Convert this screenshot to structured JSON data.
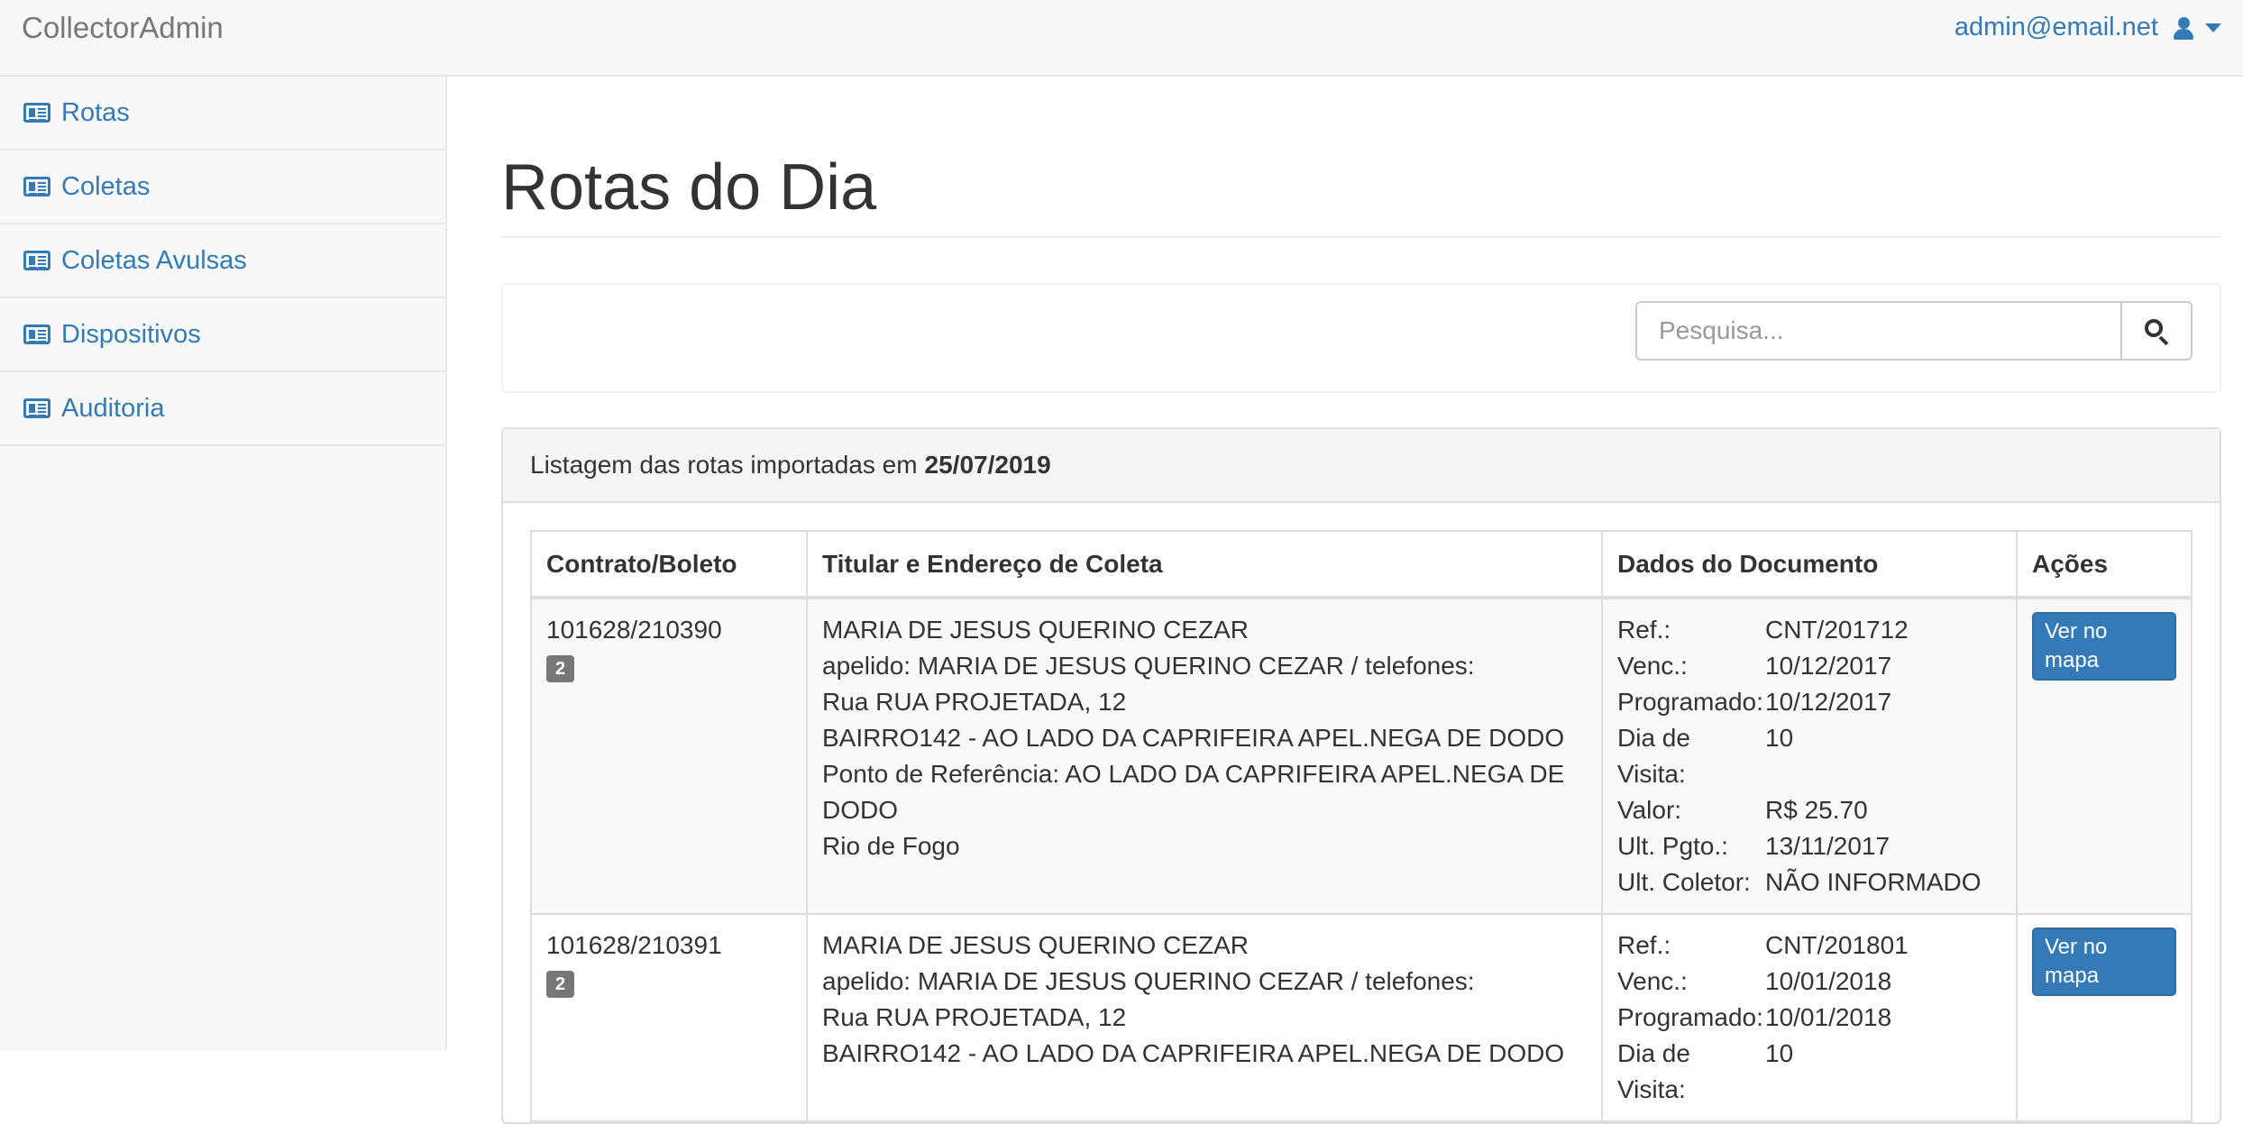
{
  "navbar": {
    "brand": "CollectorAdmin",
    "user_email": "admin@email.net",
    "user_icon": "user-icon",
    "caret_icon": "caret-down-icon"
  },
  "sidebar": {
    "items": [
      {
        "label": "Rotas",
        "icon": "newspaper-icon"
      },
      {
        "label": "Coletas",
        "icon": "newspaper-icon"
      },
      {
        "label": "Coletas Avulsas",
        "icon": "newspaper-icon"
      },
      {
        "label": "Dispositivos",
        "icon": "newspaper-icon"
      },
      {
        "label": "Auditoria",
        "icon": "newspaper-icon"
      }
    ]
  },
  "main": {
    "title": "Rotas do Dia",
    "search": {
      "placeholder": "Pesquisa...",
      "value": "",
      "icon": "search-icon"
    },
    "panel": {
      "heading_prefix": "Listagem das rotas importadas em",
      "heading_date": "25/07/2019"
    },
    "table": {
      "headers": [
        "Contrato/Boleto",
        "Titular e Endereço de Coleta",
        "Dados do Documento",
        "Ações"
      ],
      "rows": [
        {
          "contrato": "101628/210390",
          "badge": "2",
          "titular": [
            "MARIA DE JESUS QUERINO CEZAR",
            "apelido: MARIA DE JESUS QUERINO CEZAR / telefones:",
            "Rua RUA PROJETADA, 12",
            "BAIRRO142 - AO LADO DA CAPRIFEIRA APEL.NEGA DE DODO",
            "Ponto de Referência: AO LADO DA CAPRIFEIRA APEL.NEGA DE DODO",
            "Rio de Fogo"
          ],
          "documento": [
            {
              "label": "Ref.:",
              "value": "CNT/201712"
            },
            {
              "label": "Venc.:",
              "value": "10/12/2017"
            },
            {
              "label": "Programado:",
              "value": "10/12/2017"
            },
            {
              "label": "Dia de Visita:",
              "value": "10"
            },
            {
              "label": "Valor:",
              "value": "R$ 25.70"
            },
            {
              "label": "Ult. Pgto.:",
              "value": "13/11/2017"
            },
            {
              "label": "Ult. Coletor:",
              "value": "NÃO INFORMADO"
            }
          ],
          "action_label": "Ver no mapa"
        },
        {
          "contrato": "101628/210391",
          "badge": "2",
          "titular": [
            "MARIA DE JESUS QUERINO CEZAR",
            "apelido: MARIA DE JESUS QUERINO CEZAR / telefones:",
            "Rua RUA PROJETADA, 12",
            "BAIRRO142 - AO LADO DA CAPRIFEIRA APEL.NEGA DE DODO"
          ],
          "documento": [
            {
              "label": "Ref.:",
              "value": "CNT/201801"
            },
            {
              "label": "Venc.:",
              "value": "10/01/2018"
            },
            {
              "label": "Programado:",
              "value": "10/01/2018"
            },
            {
              "label": "Dia de Visita:",
              "value": "10"
            }
          ],
          "action_label": "Ver no mapa"
        }
      ]
    }
  }
}
